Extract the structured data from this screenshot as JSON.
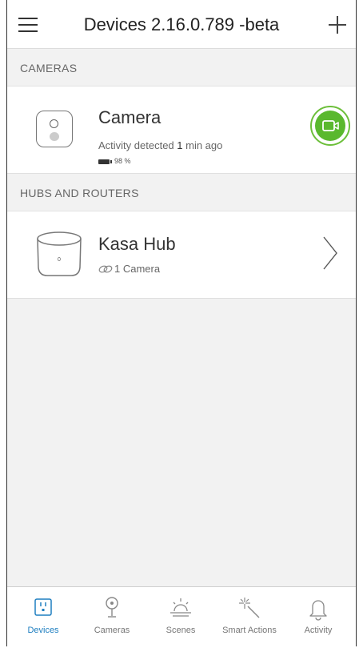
{
  "header": {
    "title": "Devices 2.16.0.789 -beta"
  },
  "sections": [
    {
      "title": "CAMERAS",
      "devices": [
        {
          "name": "Camera",
          "activity_prefix": "Activity detected ",
          "activity_time": "1",
          "activity_suffix": " min ago",
          "battery": "98 %",
          "battery_level": 0.98,
          "action_icon": "video-camera-icon",
          "accent_color": "#5ab82e"
        }
      ]
    },
    {
      "title": "HUBS AND ROUTERS",
      "devices": [
        {
          "name": "Kasa Hub",
          "linked": "1 Camera",
          "hub_label": "0",
          "action_icon": "chevron-right-icon"
        }
      ]
    }
  ],
  "tabs": [
    {
      "label": "Devices",
      "icon": "devices-icon",
      "active": true
    },
    {
      "label": "Cameras",
      "icon": "camera-icon",
      "active": false
    },
    {
      "label": "Scenes",
      "icon": "sunrise-icon",
      "active": false
    },
    {
      "label": "Smart Actions",
      "icon": "magic-wand-icon",
      "active": false
    },
    {
      "label": "Activity",
      "icon": "bell-icon",
      "active": false
    }
  ],
  "colors": {
    "active_tab": "#1f7fc0",
    "accent_green": "#5ab82e"
  }
}
